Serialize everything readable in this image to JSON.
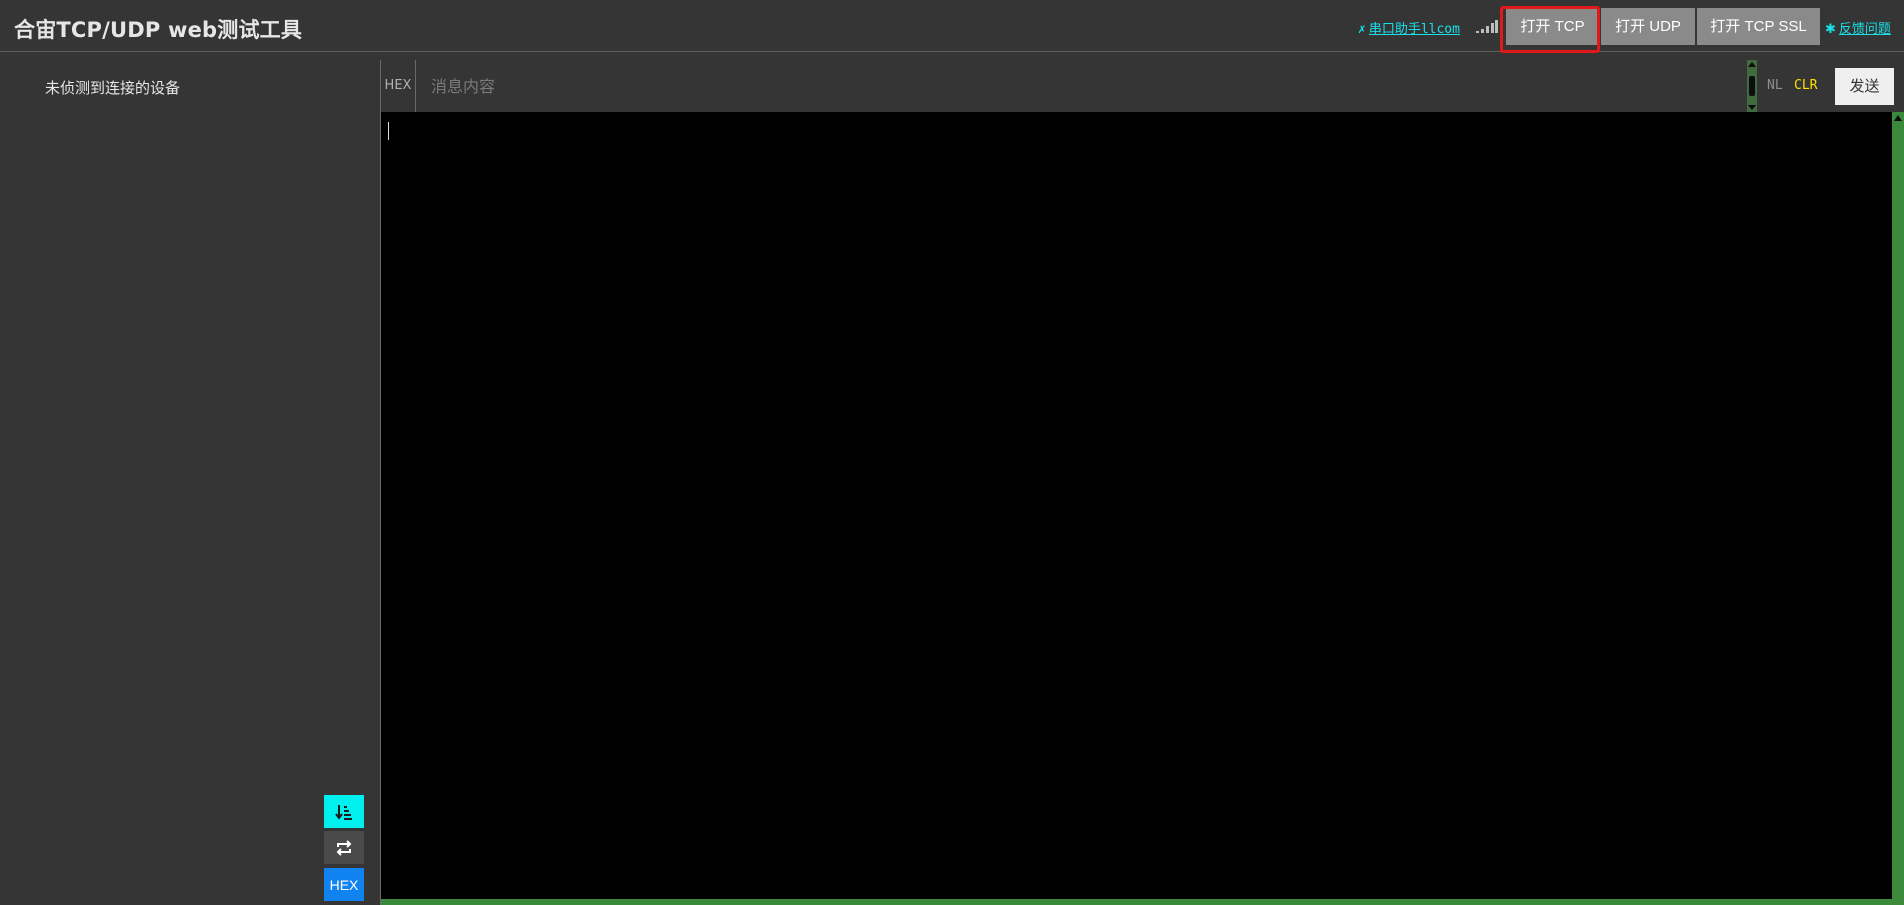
{
  "header": {
    "title": "合宙TCP/UDP web测试工具",
    "serial_link": {
      "icon": "tools-icon",
      "label": "串口助手llcom"
    },
    "stats_icon": "bars-icon",
    "buttons": {
      "open_tcp": "打开 TCP",
      "open_udp": "打开 UDP",
      "open_tcp_ssl": "打开 TCP SSL"
    },
    "feedback_link": {
      "icon": "bug-icon",
      "label": "反馈问题"
    }
  },
  "sidebar": {
    "status_text": "未侦测到连接的设备",
    "tool_buttons": {
      "sort_icon": "sort-icon",
      "loop_icon": "repeat-icon",
      "hex_label": "HEX"
    }
  },
  "input_bar": {
    "hex_label": "HEX",
    "message_placeholder": "消息内容",
    "message_value": "",
    "nl_label": "NL",
    "clr_label": "CLR",
    "send_label": "发送"
  },
  "terminal": {
    "content": ""
  },
  "colors": {
    "background": "#353535",
    "link": "#18e0ea",
    "highlight": "#e01a1a",
    "scrollbar": "#3b8a3b",
    "clr": "#ffe000",
    "hex_active": "#1083f0",
    "sort_active": "#00f0f0"
  }
}
